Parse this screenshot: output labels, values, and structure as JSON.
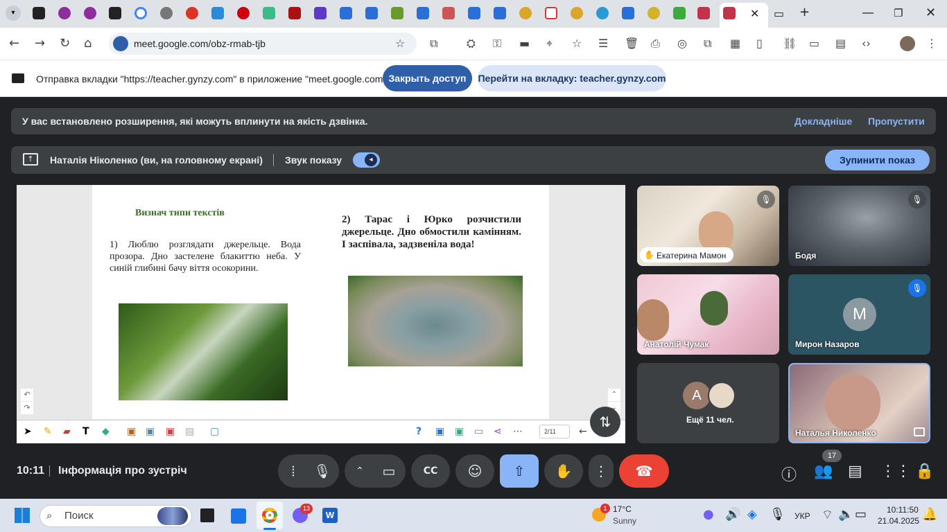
{
  "browser": {
    "tabs_icons": [
      "chrome-menu-icon",
      "app-icon",
      "q-icon",
      "q-icon",
      "analytics-icon",
      "google-icon",
      "globe-icon",
      "red-ball-icon",
      "puzzle-icon",
      "red-ball-icon",
      "d-icon",
      "fi-icon",
      "app-icon",
      "g-docs-icon",
      "g-docs-icon",
      "grid-icon",
      "g-docs-icon",
      "books-icon",
      "g-docs-icon",
      "g-docs-icon",
      "link-icon",
      "gmail-icon",
      "link-icon",
      "snowflake-icon",
      "g-docs-icon",
      "emblem-icon",
      "bolt-icon",
      "gynzy-icon",
      "gynzy-icon"
    ],
    "url": "meet.google.com/obz-rmab-tjb",
    "new_tab": "+"
  },
  "infobar": {
    "text": "Отправка вкладки \"https://teacher.gynzy.com\" в приложение \"meet.google.com\"...",
    "stop_access": "Закрыть доступ",
    "go_to_tab": "Перейти на вкладку: teacher.gynzy.com"
  },
  "meet": {
    "ext_banner": "У вас встановлено розширення, які можуть вплинути на якість дзвінка.",
    "ext_more": "Докладніше",
    "ext_skip": "Пропустити",
    "presenting": "Наталія Ніколенко (ви, на головному екрані)",
    "show_sound": "Звук показу",
    "stop_show": "Зупинити показ",
    "time": "10:11",
    "meeting_info": "Інформація про зустріч",
    "participants_count": "17"
  },
  "slide": {
    "title": "Визнач типи текстів",
    "text1": "1) Люблю розглядати джерельце. Вода прозора. Дно застелене блакиттю неба. У синій глибині бачу віття осокорини.",
    "text2": "2) Тарас і Юрко розчистили джерельце. Дно обмостили камінням. І заспівала, задзвеніла вода!",
    "page": "2/11"
  },
  "participants": [
    {
      "name": "Екатерина Мамон",
      "muted": true
    },
    {
      "name": "Бодя",
      "muted": true
    },
    {
      "name": "Анатолій Чумак",
      "muted": false
    },
    {
      "name": "Мирон Назаров",
      "initial": "M",
      "muted": true
    },
    {
      "name": "Ещё 11 чел.",
      "initial": "A"
    },
    {
      "name": "Наталья Николенко",
      "muted": false
    }
  ],
  "taskbar": {
    "search": "Поиск",
    "weather_temp": "17°C",
    "weather_desc": "Sunny",
    "weather_badge": "1",
    "viber_badge": "13",
    "lang": "УКР",
    "clock_time": "10:11:50",
    "clock_date": "21.04.2025"
  },
  "colors": {
    "meet_bg": "#202124",
    "accent_blue": "#8ab4f8",
    "end_call": "#ea4335",
    "infobar_button": "#2f5fa8"
  }
}
